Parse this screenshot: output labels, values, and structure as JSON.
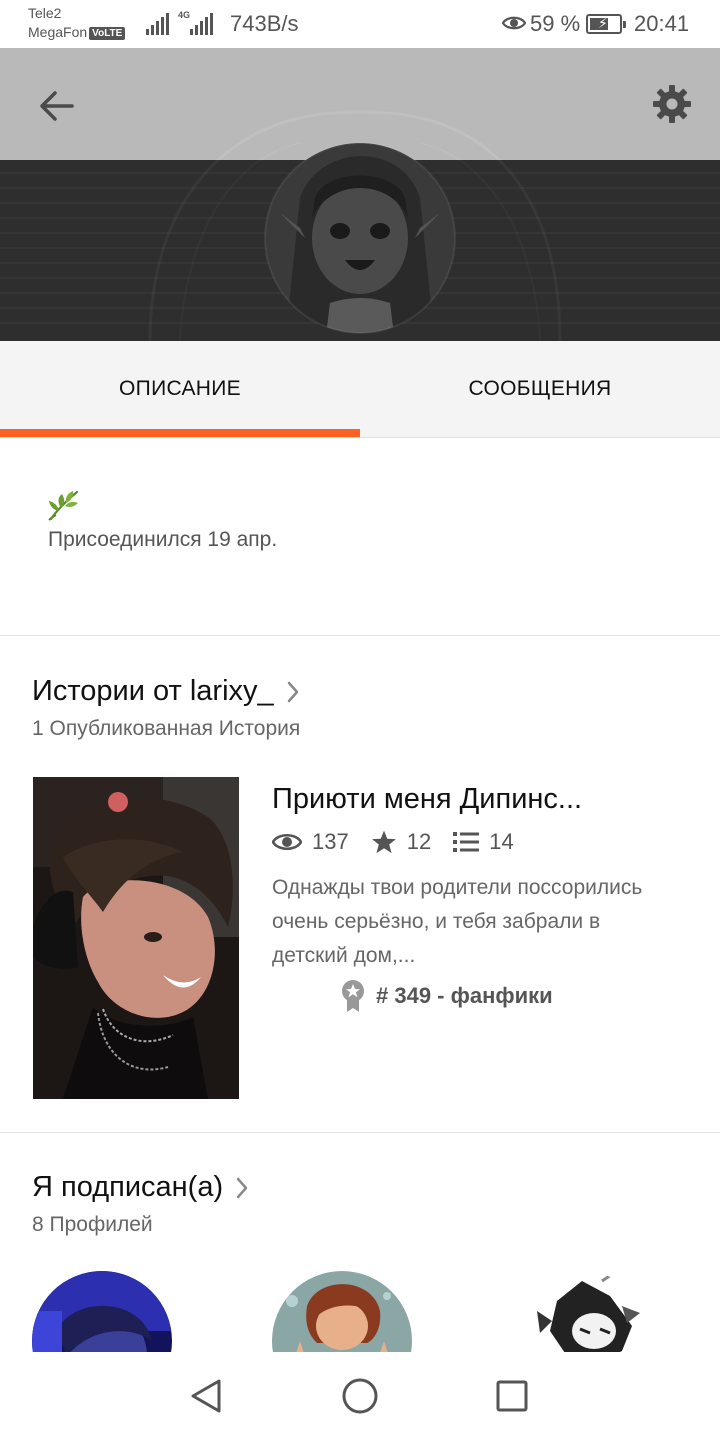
{
  "status_bar": {
    "carrier_1": "Tele2",
    "carrier_2": "MegaFon",
    "volte": "VoLTE",
    "network_type": "4G",
    "speed": "743B/s",
    "battery_percent": "59 %",
    "time": "20:41"
  },
  "tabs": [
    {
      "label": "ОПИСАНИЕ",
      "active": true
    },
    {
      "label": "СООБЩЕНИЯ",
      "active": false
    }
  ],
  "about": {
    "icon": "leaf-icon",
    "joined_text": "Присоединился 19 апр."
  },
  "stories_section": {
    "title": "Истории от larixy_",
    "subtitle": "1 Опубликованная История",
    "story": {
      "title": "Приюти меня Дипинс...",
      "views": "137",
      "votes": "12",
      "parts": "14",
      "description": "Однажды твои родители поссорились очень серьёзно, и тебя забрали в детский дом,...",
      "rank": "# 349 - фанфики"
    }
  },
  "following_section": {
    "title": "Я подписан(а)",
    "subtitle": "8 Профилей"
  },
  "colors": {
    "accent": "#ff6122",
    "header_bar": "#b9b9b9",
    "header_dark": "#2f2f2f",
    "text_secondary": "#666666"
  }
}
